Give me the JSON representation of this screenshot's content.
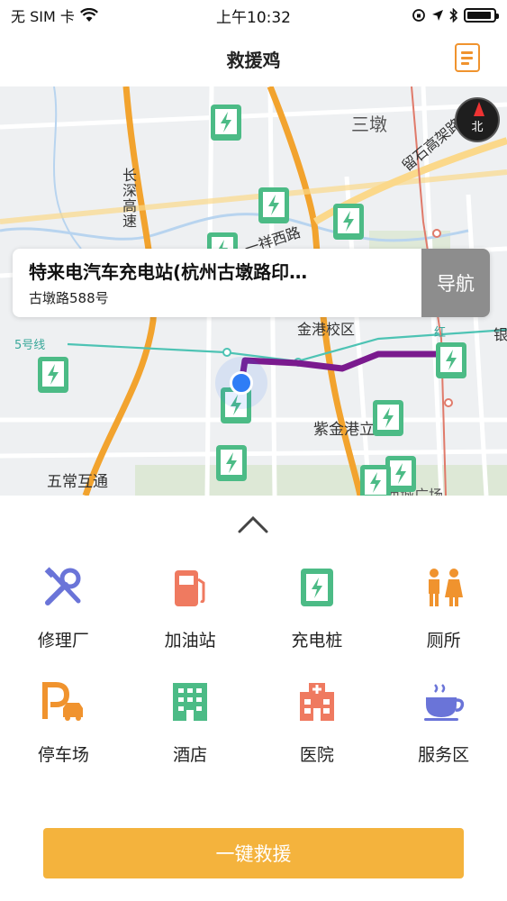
{
  "status_bar": {
    "carrier": "无 SIM 卡",
    "time": "上午10:32",
    "battery_level": 0.92
  },
  "nav": {
    "title": "救援鸡",
    "doc_icon": "document-list-icon"
  },
  "map": {
    "labels": {
      "sandun": "三墩",
      "liushi": "留石高架路",
      "changshen": "长深高速",
      "xiangxi": "一祥西路",
      "jingang": "金港校区",
      "line5": "5号线",
      "zijin": "紫金港立",
      "wuchang": "五常互通",
      "xicheng": "西城广场",
      "yin": "银",
      "gu": "红"
    },
    "compass_label": "北",
    "route_color": "#7a1a8e",
    "pin_color": "#4cbb86"
  },
  "info_card": {
    "name": "特来电汽车充电站(杭州古墩路印…",
    "address": "古墩路588号",
    "nav_button": "导航"
  },
  "categories": [
    {
      "label": "修理厂",
      "icon": "repair-tools-icon",
      "color": "#6a74d8"
    },
    {
      "label": "加油站",
      "icon": "gas-pump-icon",
      "color": "#ef7a60"
    },
    {
      "label": "充电桩",
      "icon": "charging-station-icon",
      "color": "#4cbb86"
    },
    {
      "label": "厕所",
      "icon": "restroom-icon",
      "color": "#f0932e"
    },
    {
      "label": "停车场",
      "icon": "parking-icon",
      "color": "#f0932e"
    },
    {
      "label": "酒店",
      "icon": "hotel-icon",
      "color": "#4cbb86"
    },
    {
      "label": "医院",
      "icon": "hospital-icon",
      "color": "#ef7a60"
    },
    {
      "label": "服务区",
      "icon": "service-area-cup-icon",
      "color": "#6a74d8"
    }
  ],
  "rescue_button": "一键救援",
  "colors": {
    "accent": "#f4b33d",
    "nav_doc": "#f0932e"
  }
}
